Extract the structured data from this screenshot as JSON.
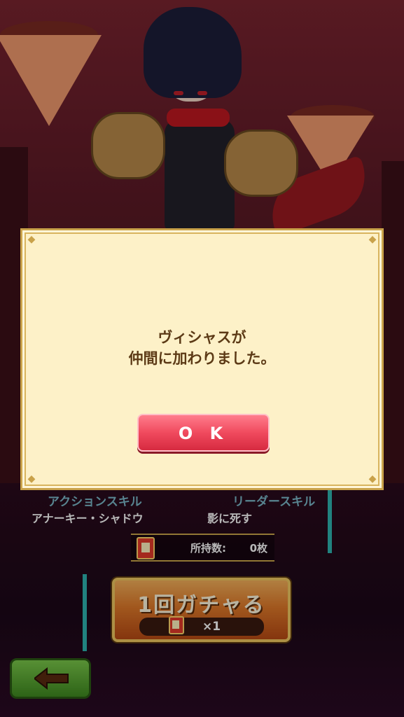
{
  "dialog": {
    "message_line1": "ヴィシャスが",
    "message_line2": "仲間に加わりました。",
    "ok_label": "O K"
  },
  "skills": {
    "action_label": "アクションスキル",
    "action_name": "アナーキー・シャドウ",
    "leader_label": "リーダースキル",
    "leader_name": "影に死す"
  },
  "tickets": {
    "owned_label": "所持数:",
    "owned_count": "0枚"
  },
  "gacha": {
    "button_label": "1回ガチャる",
    "cost_label": "×1"
  },
  "colors": {
    "dialog_bg": "#fdf1c8",
    "ok_button": "#f04a5e",
    "gacha_button": "#e07a2a",
    "back_button": "#5aa838"
  },
  "icons": {
    "back": "left-arrow-icon",
    "ticket": "ticket-icon"
  }
}
